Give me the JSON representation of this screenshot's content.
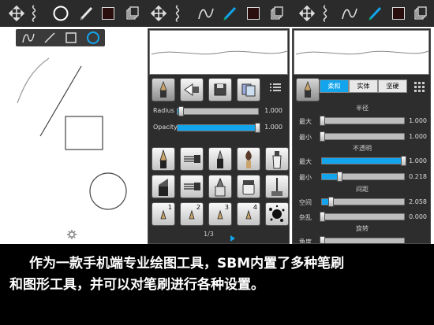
{
  "toolbar": {
    "icons": [
      "move-icon",
      "lasso-icon",
      "circle-tool-icon",
      "pen-icon",
      "color-swatch-icon",
      "layers-icon"
    ],
    "accent": "#12a5ee"
  },
  "shape_popup": {
    "icons": [
      "freehand-icon",
      "line-icon",
      "rectangle-icon",
      "ellipse-icon"
    ]
  },
  "brush_panel": {
    "radius_label": "Radius",
    "radius_value": "1.000",
    "radius_level": 0.05,
    "opacity_label": "Opacity",
    "opacity_value": "1.000",
    "opacity_level": 1.0,
    "numbered_brushes": [
      "1",
      "2",
      "3",
      "4"
    ],
    "page_indicator": "1/3"
  },
  "settings_panel": {
    "tabs": [
      "柔和",
      "实体",
      "坚硬"
    ],
    "active_tab": 0,
    "sections": {
      "radius_title": "半径",
      "opacity_title": "不透明",
      "spacing_title": "间距",
      "rotation_title": "旋转"
    },
    "rows": [
      {
        "label": "最大",
        "value": "1.000",
        "level": 0.01
      },
      {
        "label": "最小",
        "value": "1.000",
        "level": 0.01
      },
      {
        "label": "最大",
        "value": "1.000",
        "level": 1.0
      },
      {
        "label": "最小",
        "value": "0.218",
        "level": 0.218
      },
      {
        "label": "空间",
        "value": "2.058",
        "level": 0.12
      },
      {
        "label": "杂乱",
        "value": "0.000",
        "level": 0.01
      },
      {
        "label": "角度",
        "value": "",
        "level": 0.01
      }
    ]
  },
  "caption": {
    "line1": "作为一款手机端专业绘图工具，SBM内置了多种笔刷",
    "line2": "和图形工具，并可以对笔刷进行各种设置。"
  }
}
